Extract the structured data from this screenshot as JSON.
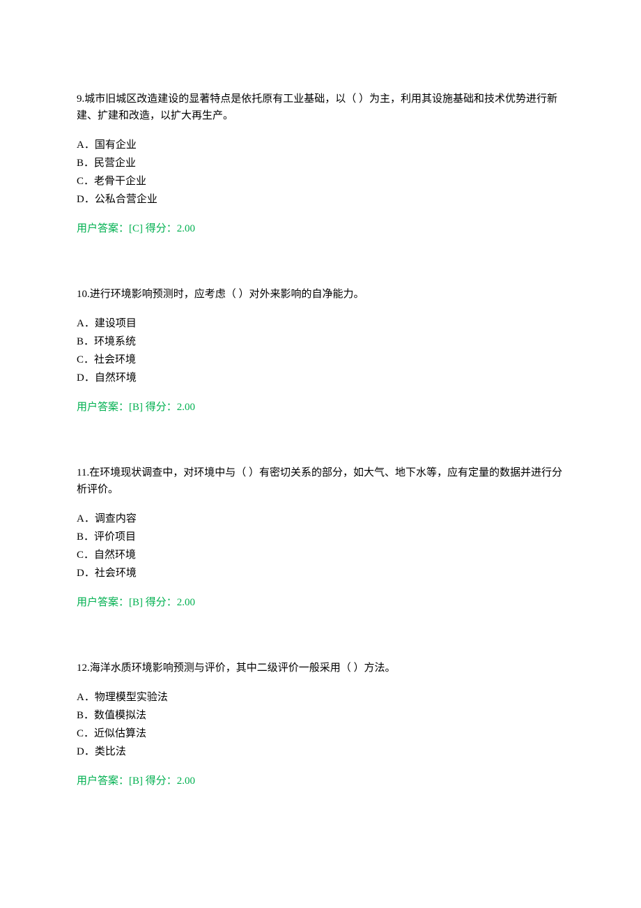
{
  "questions": [
    {
      "number": "9.",
      "text": "城市旧城区改造建设的显著特点是依托原有工业基础，以（ ）为主，利用其设施基础和技术优势进行新建、扩建和改造，以扩大再生产。",
      "options": [
        "A．国有企业",
        "B．民营企业",
        "C．老骨干企业",
        "D．公私合营企业"
      ],
      "answer": "用户答案：[C] 得分：2.00"
    },
    {
      "number": "10.",
      "text": "进行环境影响预测时，应考虑（ ）对外来影响的自净能力。",
      "options": [
        "A．建设项目",
        "B．环境系统",
        "C．社会环境",
        "D．自然环境"
      ],
      "answer": "用户答案：[B] 得分：2.00"
    },
    {
      "number": "11.",
      "text": "在环境现状调查中，对环境中与（ ）有密切关系的部分，如大气、地下水等，应有定量的数据并进行分析评价。",
      "options": [
        "A．调查内容",
        "B．评价项目",
        "C．自然环境",
        "D．社会环境"
      ],
      "answer": "用户答案：[B] 得分：2.00"
    },
    {
      "number": "12.",
      "text": "海洋水质环境影响预测与评价，其中二级评价一般采用（ ）方法。",
      "options": [
        "A．物理模型实验法",
        "B．数值模拟法",
        "C．近似估算法",
        "D．类比法"
      ],
      "answer": "用户答案：[B] 得分：2.00"
    }
  ]
}
